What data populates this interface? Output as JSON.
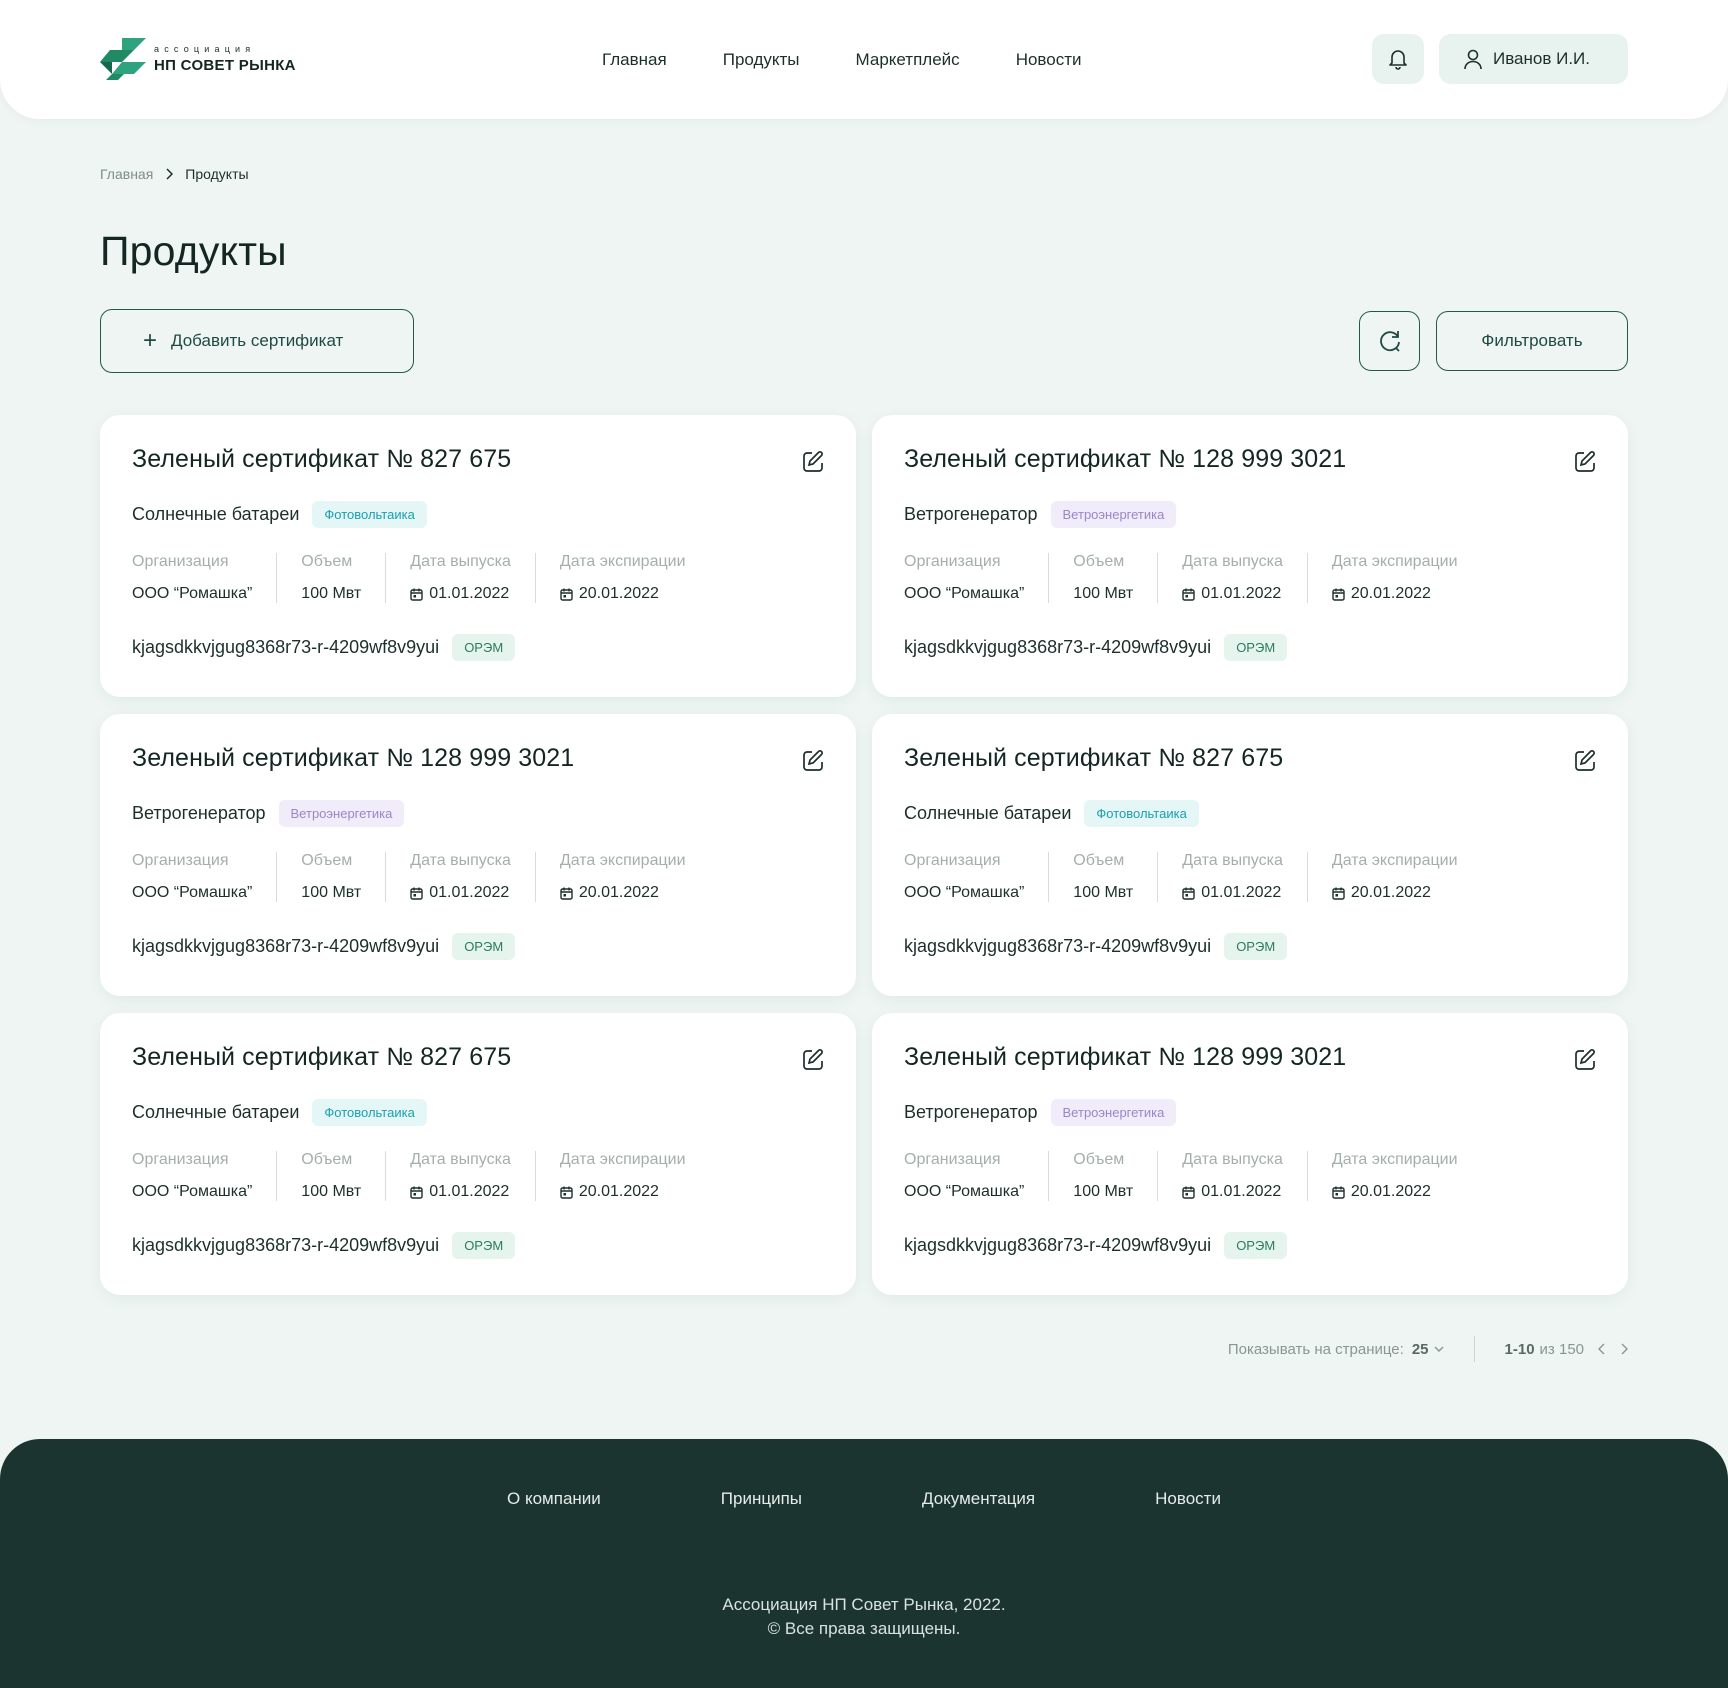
{
  "header": {
    "logo_small": "ассоциация",
    "logo_big": "НП СОВЕТ РЫНКА",
    "nav": [
      "Главная",
      "Продукты",
      "Маркетплейс",
      "Новости"
    ],
    "user_name": "Иванов И.И."
  },
  "breadcrumb": {
    "home": "Главная",
    "current": "Продукты"
  },
  "page_title": "Продукты",
  "actions": {
    "add_label": "Добавить сертификат",
    "filter_label": "Фильтровать"
  },
  "field_labels": {
    "org": "Организация",
    "volume": "Объем",
    "issue": "Дата выпуска",
    "expiry": "Дата экспирации"
  },
  "cards": [
    {
      "title": "Зеленый сертификат № 827 675",
      "subtitle": "Солнечные батареи",
      "tag": "Фотовольтаика",
      "tag_kind": "solar",
      "org": "ООО “Ромашка”",
      "volume": "100 Мвт",
      "issue": "01.01.2022",
      "expiry": "20.01.2022",
      "id": "kjagsdkkvjgug8368r73-r-4209wf8v9yui",
      "market": "ОРЭМ"
    },
    {
      "title": "Зеленый сертификат № 128 999 3021",
      "subtitle": "Ветрогенератор",
      "tag": "Ветроэнергетика",
      "tag_kind": "wind",
      "org": "ООО “Ромашка”",
      "volume": "100 Мвт",
      "issue": "01.01.2022",
      "expiry": "20.01.2022",
      "id": "kjagsdkkvjgug8368r73-r-4209wf8v9yui",
      "market": "ОРЭМ"
    },
    {
      "title": "Зеленый сертификат № 128 999 3021",
      "subtitle": "Ветрогенератор",
      "tag": "Ветроэнергетика",
      "tag_kind": "wind",
      "org": "ООО “Ромашка”",
      "volume": "100 Мвт",
      "issue": "01.01.2022",
      "expiry": "20.01.2022",
      "id": "kjagsdkkvjgug8368r73-r-4209wf8v9yui",
      "market": "ОРЭМ"
    },
    {
      "title": "Зеленый сертификат № 827 675",
      "subtitle": "Солнечные батареи",
      "tag": "Фотовольтаика",
      "tag_kind": "solar",
      "org": "ООО “Ромашка”",
      "volume": "100 Мвт",
      "issue": "01.01.2022",
      "expiry": "20.01.2022",
      "id": "kjagsdkkvjgug8368r73-r-4209wf8v9yui",
      "market": "ОРЭМ"
    },
    {
      "title": "Зеленый сертификат № 827 675",
      "subtitle": "Солнечные батареи",
      "tag": "Фотовольтаика",
      "tag_kind": "solar",
      "org": "ООО “Ромашка”",
      "volume": "100 Мвт",
      "issue": "01.01.2022",
      "expiry": "20.01.2022",
      "id": "kjagsdkkvjgug8368r73-r-4209wf8v9yui",
      "market": "ОРЭМ"
    },
    {
      "title": "Зеленый сертификат № 128 999 3021",
      "subtitle": "Ветрогенератор",
      "tag": "Ветроэнергетика",
      "tag_kind": "wind",
      "org": "ООО “Ромашка”",
      "volume": "100 Мвт",
      "issue": "01.01.2022",
      "expiry": "20.01.2022",
      "id": "kjagsdkkvjgug8368r73-r-4209wf8v9yui",
      "market": "ОРЭМ"
    }
  ],
  "pagination": {
    "per_page_label": "Показывать на странице:",
    "per_page_value": "25",
    "range": "1-10",
    "of_label": "из 150"
  },
  "footer": {
    "nav": [
      "О компании",
      "Принципы",
      "Документация",
      "Новости"
    ],
    "copyright_line1": "Ассоциация НП Совет Рынка, 2022.",
    "copyright_line2": "© Все права защищены."
  },
  "colors": {
    "background": "#eef5f3",
    "accent": "#1f5a4e",
    "footer": "#1c3430",
    "tag_solar": "#1a9fb0",
    "tag_wind": "#9a86c8",
    "tag_orem": "#2b7a62"
  },
  "icons": [
    "logo-icon",
    "bell-icon",
    "user-icon",
    "chevron-right-icon",
    "plus-icon",
    "refresh-icon",
    "edit-icon",
    "calendar-icon",
    "chevron-down-icon",
    "chevron-left-icon"
  ]
}
